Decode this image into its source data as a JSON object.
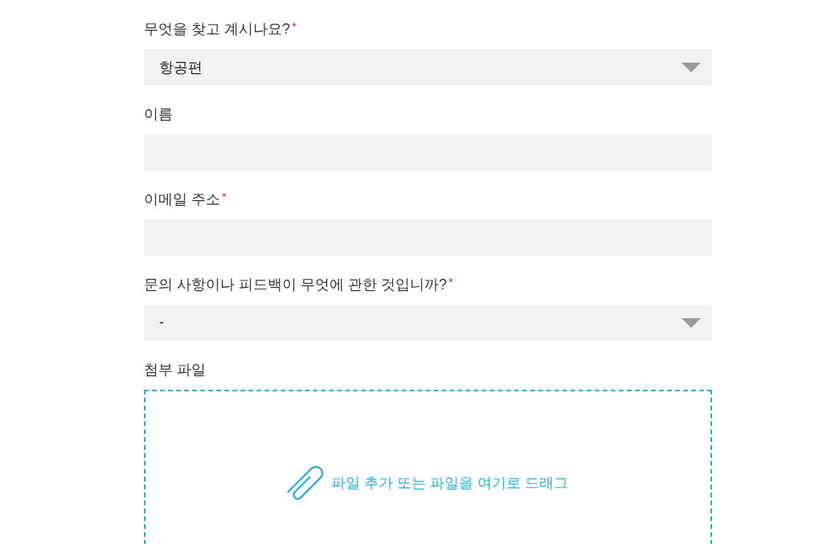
{
  "fields": [
    {
      "kind": "select",
      "label": "무엇을 찾고 계시나요?",
      "required_mark": "*",
      "value": "항공편"
    },
    {
      "kind": "text",
      "label": "이름"
    },
    {
      "kind": "text",
      "label": "이메일 주소",
      "required_mark": "*"
    },
    {
      "kind": "select",
      "label": "문의 사항이나 피드백이 무엇에 관한 것입니까?",
      "required_mark": "*",
      "value": "-"
    },
    {
      "kind": "dropzone",
      "label": "첨부 파일",
      "prompt": "파일 추가 또는 파일을 여기로 드래그"
    }
  ]
}
